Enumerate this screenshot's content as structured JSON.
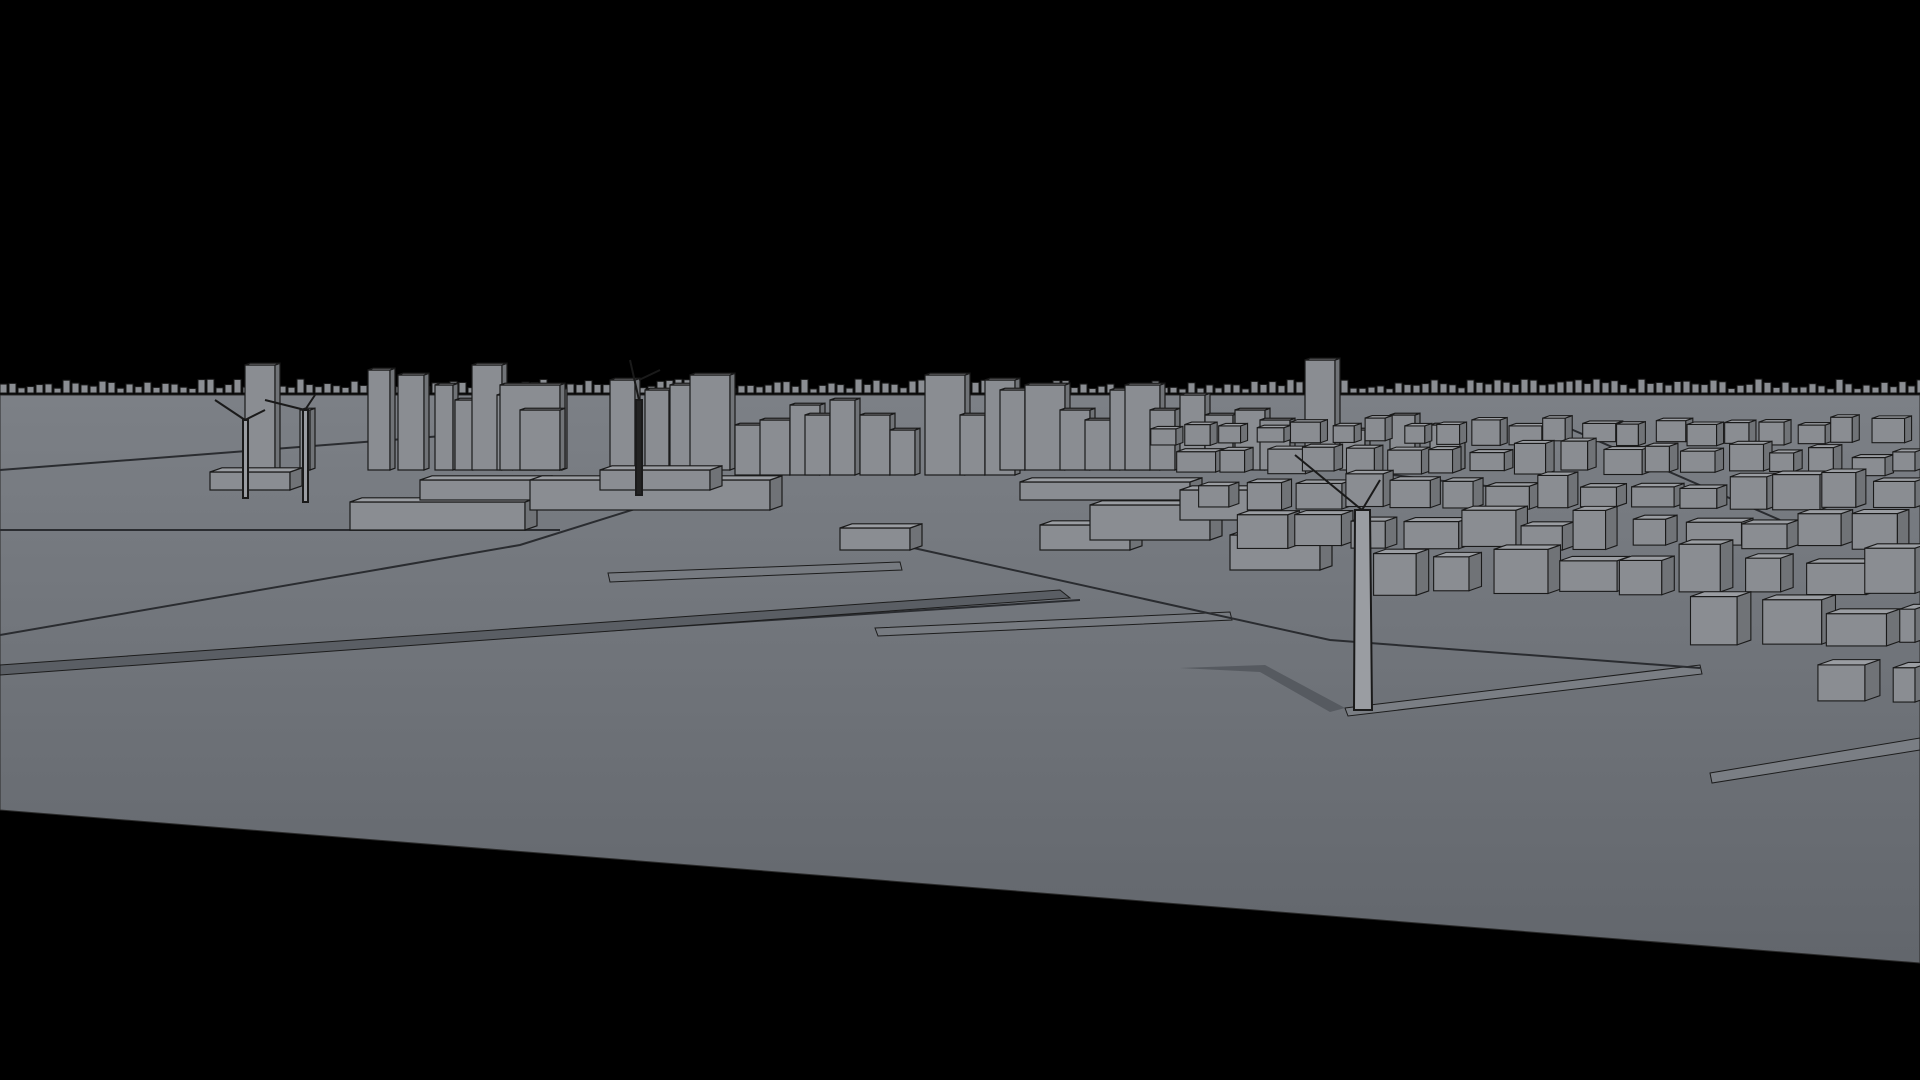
{
  "scene": {
    "description_free": true,
    "colors": {
      "background": "#000000",
      "ground": "#6a6e74",
      "ground_far": "#7a7e84",
      "building_front": "#8a8d92",
      "building_side": "#707377",
      "building_top": "#9a9da2",
      "edge": "#1a1a1a",
      "road": "#5c6066"
    },
    "elements": [
      "ground-plane",
      "downtown-skyline",
      "industrial-warehouses",
      "residential-district",
      "wind-turbines",
      "piers",
      "roads"
    ]
  }
}
